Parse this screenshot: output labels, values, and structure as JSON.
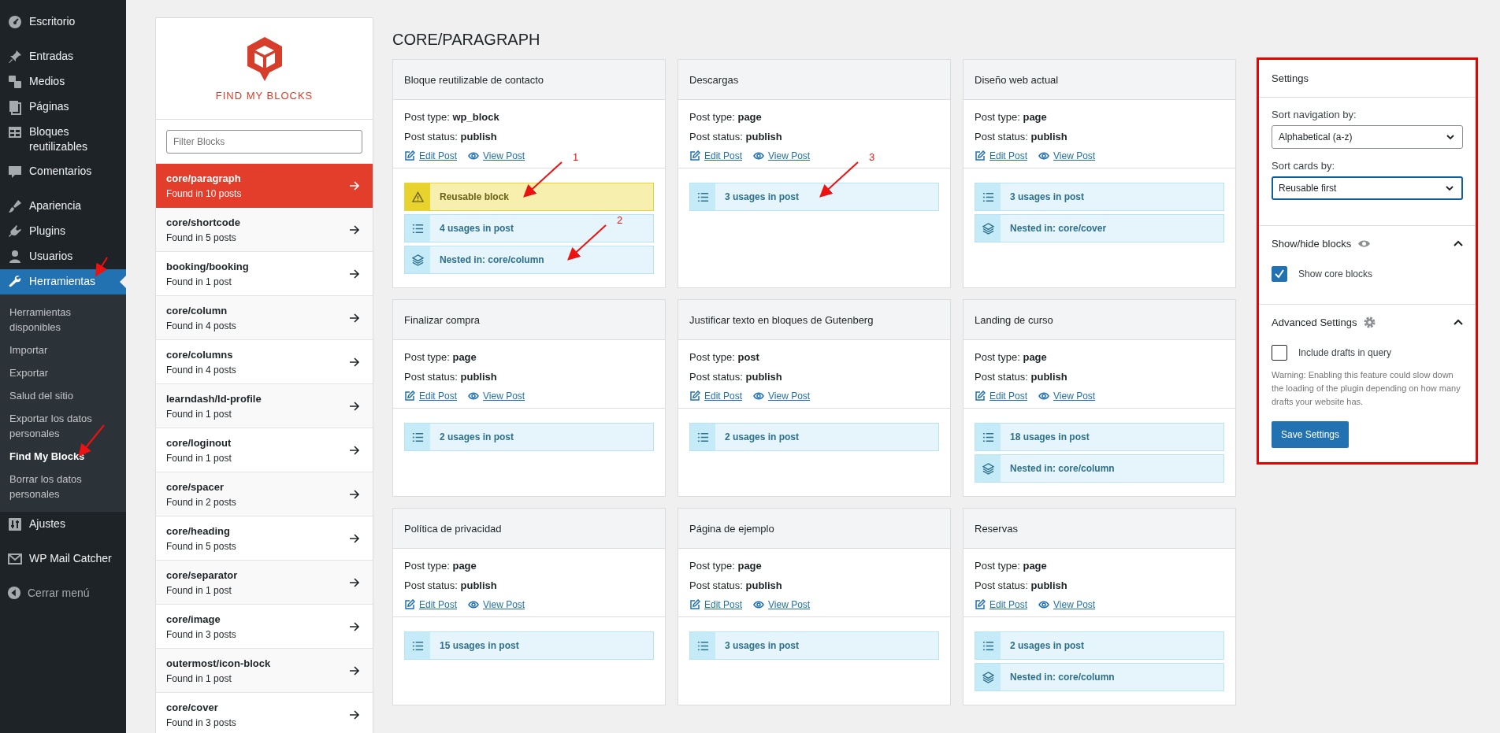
{
  "admin_menu": {
    "groups": [
      [
        {
          "label": "Escritorio",
          "current": false
        }
      ],
      [
        {
          "label": "Entradas",
          "current": false
        },
        {
          "label": "Medios",
          "current": false
        },
        {
          "label": "Páginas",
          "current": false
        },
        {
          "label": "Bloques reutilizables",
          "current": false
        },
        {
          "label": "Comentarios",
          "current": false
        }
      ],
      [
        {
          "label": "Apariencia",
          "current": false
        },
        {
          "label": "Plugins",
          "current": false
        },
        {
          "label": "Usuarios",
          "current": false
        },
        {
          "label": "Herramientas",
          "current": true,
          "annotated": true,
          "children": [
            {
              "label": "Herramientas disponibles",
              "current": false
            },
            {
              "label": "Importar",
              "current": false
            },
            {
              "label": "Exportar",
              "current": false
            },
            {
              "label": "Salud del sitio",
              "current": false
            },
            {
              "label": "Exportar los datos personales",
              "current": false
            },
            {
              "label": "Find My Blocks",
              "current": true,
              "annotated": true
            },
            {
              "label": "Borrar los datos personales",
              "current": false
            }
          ]
        },
        {
          "label": "Ajustes",
          "current": false
        }
      ],
      [
        {
          "label": "WP Mail Catcher",
          "current": false
        }
      ]
    ],
    "collapse": "Cerrar menú"
  },
  "block_nav": {
    "logo_text": "FIND MY BLOCKS",
    "filter": {
      "placeholder": "Filter Blocks"
    },
    "items": [
      {
        "name": "core/paragraph",
        "count": "Found in 10 posts",
        "selected": true
      },
      {
        "name": "core/shortcode",
        "count": "Found in 5 posts",
        "selected": false
      },
      {
        "name": "booking/booking",
        "count": "Found in 1 post",
        "selected": false
      },
      {
        "name": "core/column",
        "count": "Found in 4 posts",
        "selected": false
      },
      {
        "name": "core/columns",
        "count": "Found in 4 posts",
        "selected": false
      },
      {
        "name": "learndash/ld-profile",
        "count": "Found in 1 post",
        "selected": false
      },
      {
        "name": "core/loginout",
        "count": "Found in 1 post",
        "selected": false
      },
      {
        "name": "core/spacer",
        "count": "Found in 2 posts",
        "selected": false
      },
      {
        "name": "core/heading",
        "count": "Found in 5 posts",
        "selected": false
      },
      {
        "name": "core/separator",
        "count": "Found in 1 post",
        "selected": false
      },
      {
        "name": "core/image",
        "count": "Found in 3 posts",
        "selected": false
      },
      {
        "name": "outermost/icon-block",
        "count": "Found in 1 post",
        "selected": false
      },
      {
        "name": "core/cover",
        "count": "Found in 3 posts",
        "selected": false
      }
    ]
  },
  "main": {
    "heading": "CORE/PARAGRAPH",
    "cards": [
      {
        "title": "Bloque reutilizable de contacto",
        "post_type": {
          "label": "Post type:",
          "value": "wp_block"
        },
        "post_status": {
          "label": "Post status:",
          "value": "publish"
        },
        "links": [
          "Edit Post",
          "View Post"
        ],
        "badges": [
          {
            "kind": "warning",
            "text": "Reusable block",
            "callout": "1"
          },
          {
            "kind": "usages",
            "text": "4 usages in post"
          },
          {
            "kind": "nested",
            "text": "Nested in: core/column",
            "callout": "2"
          }
        ]
      },
      {
        "title": "Descargas",
        "post_type": {
          "label": "Post type:",
          "value": "page"
        },
        "post_status": {
          "label": "Post status:",
          "value": "publish"
        },
        "links": [
          "Edit Post",
          "View Post"
        ],
        "badges": [
          {
            "kind": "usages",
            "text": "3 usages in post",
            "callout": "3"
          }
        ]
      },
      {
        "title": "Diseño web actual",
        "post_type": {
          "label": "Post type:",
          "value": "page"
        },
        "post_status": {
          "label": "Post status:",
          "value": "publish"
        },
        "links": [
          "Edit Post",
          "View Post"
        ],
        "badges": [
          {
            "kind": "usages",
            "text": "3 usages in post"
          },
          {
            "kind": "nested",
            "text": "Nested in: core/cover"
          }
        ]
      },
      {
        "title": "Finalizar compra",
        "post_type": {
          "label": "Post type:",
          "value": "page"
        },
        "post_status": {
          "label": "Post status:",
          "value": "publish"
        },
        "links": [
          "Edit Post",
          "View Post"
        ],
        "badges": [
          {
            "kind": "usages",
            "text": "2 usages in post"
          }
        ]
      },
      {
        "title": "Justificar texto en bloques de Gutenberg",
        "post_type": {
          "label": "Post type:",
          "value": "post"
        },
        "post_status": {
          "label": "Post status:",
          "value": "publish"
        },
        "links": [
          "Edit Post",
          "View Post"
        ],
        "badges": [
          {
            "kind": "usages",
            "text": "2 usages in post"
          }
        ]
      },
      {
        "title": "Landing de curso",
        "post_type": {
          "label": "Post type:",
          "value": "page"
        },
        "post_status": {
          "label": "Post status:",
          "value": "publish"
        },
        "links": [
          "Edit Post",
          "View Post"
        ],
        "badges": [
          {
            "kind": "usages",
            "text": "18 usages in post"
          },
          {
            "kind": "nested",
            "text": "Nested in: core/column"
          }
        ]
      },
      {
        "title": "Política de privacidad",
        "post_type": {
          "label": "Post type:",
          "value": "page"
        },
        "post_status": {
          "label": "Post status:",
          "value": "publish"
        },
        "links": [
          "Edit Post",
          "View Post"
        ],
        "badges": [
          {
            "kind": "usages",
            "text": "15 usages in post"
          }
        ]
      },
      {
        "title": "Página de ejemplo",
        "post_type": {
          "label": "Post type:",
          "value": "page"
        },
        "post_status": {
          "label": "Post status:",
          "value": "publish"
        },
        "links": [
          "Edit Post",
          "View Post"
        ],
        "badges": [
          {
            "kind": "usages",
            "text": "3 usages in post"
          }
        ]
      },
      {
        "title": "Reservas",
        "post_type": {
          "label": "Post type:",
          "value": "page"
        },
        "post_status": {
          "label": "Post status:",
          "value": "publish"
        },
        "links": [
          "Edit Post",
          "View Post"
        ],
        "badges": [
          {
            "kind": "usages",
            "text": "2 usages in post"
          },
          {
            "kind": "nested",
            "text": "Nested in: core/column"
          }
        ]
      }
    ]
  },
  "settings": {
    "title": "Settings",
    "highlighted": true,
    "sort_navigation": {
      "label": "Sort navigation by:",
      "value": "Alphabetical (a-z)",
      "focused": false
    },
    "sort_cards": {
      "label": "Sort cards by:",
      "value": "Reusable first",
      "focused": true
    },
    "sections": [
      {
        "title": "Show/hide blocks",
        "expanded": true,
        "options": [
          {
            "label": "Show core blocks",
            "checked": true
          }
        ]
      },
      {
        "title": "Advanced Settings",
        "expanded": true,
        "options": [
          {
            "label": "Include drafts in query",
            "checked": false
          }
        ],
        "note": "Warning: Enabling this feature could slow down the loading of the plugin depending on how many drafts your website has."
      }
    ],
    "save_button": "Save Settings"
  }
}
